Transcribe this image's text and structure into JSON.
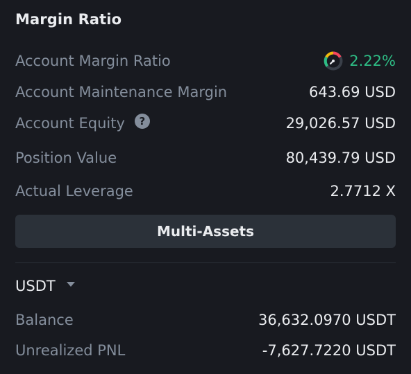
{
  "panel": {
    "title": "Margin Ratio"
  },
  "metrics": {
    "margin_ratio": {
      "label": "Account Margin Ratio",
      "value": "2.22%",
      "icon": "gauge-icon",
      "color": "#2ebd85"
    },
    "maintenance_margin": {
      "label": "Account Maintenance Margin",
      "value": "643.69 USD"
    },
    "equity": {
      "label": "Account Equity",
      "value": "29,026.57 USD",
      "help_icon": "?"
    },
    "position_value": {
      "label": "Position Value",
      "value": "80,439.79 USD"
    },
    "actual_leverage": {
      "label": "Actual Leverage",
      "value": "2.7712 X"
    }
  },
  "button": {
    "label": "Multi-Assets"
  },
  "asset": {
    "selected": "USDT",
    "balance": {
      "label": "Balance",
      "value": "36,632.0970 USDT"
    },
    "unrealized_pnl": {
      "label": "Unrealized PNL",
      "value": "-7,627.7220 USDT"
    }
  },
  "colors": {
    "background": "#181a20",
    "label": "#848e9c",
    "value": "#eaecef",
    "positive": "#2ebd85",
    "button_bg": "#2b3139"
  }
}
